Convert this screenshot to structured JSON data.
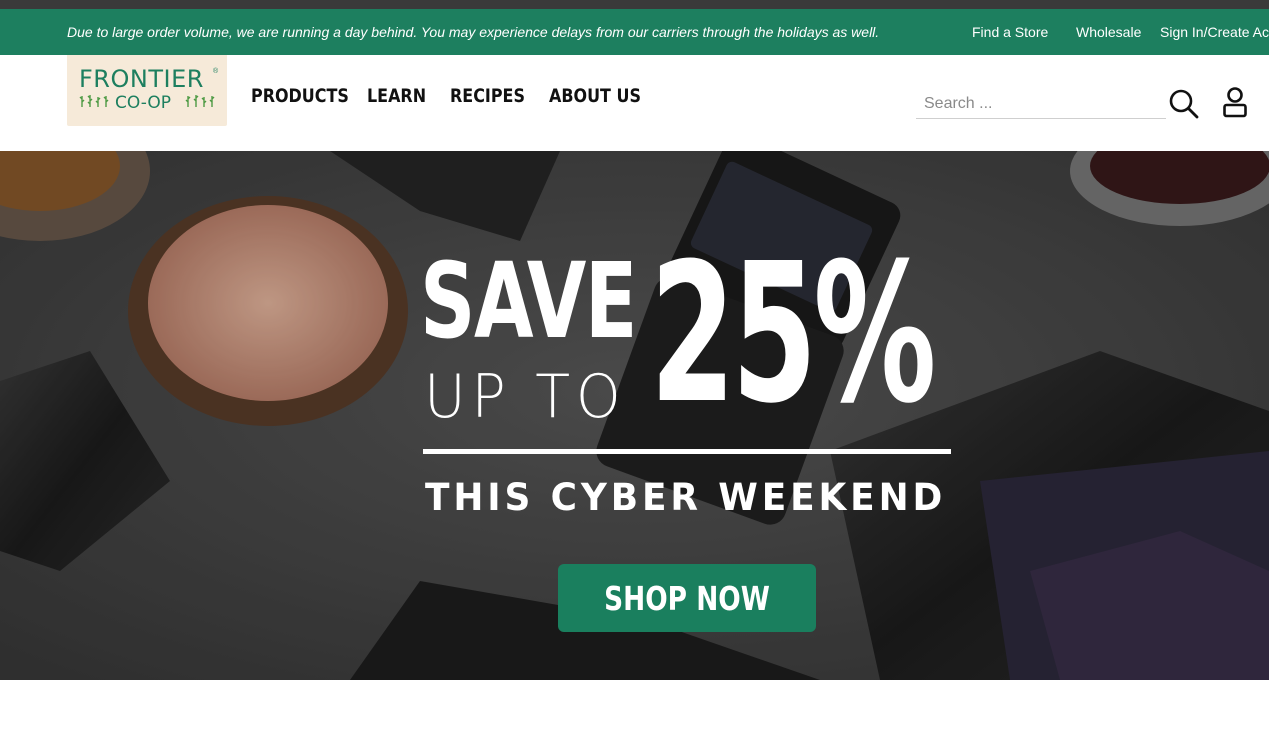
{
  "announcement": {
    "text": "Due to large order volume, we are running a day behind. You may experience delays from our carriers through the holidays as well."
  },
  "utility_nav": {
    "find_store": "Find a Store",
    "wholesale": "Wholesale",
    "sign_in": "Sign In/Create Ac"
  },
  "logo": {
    "line1": "FRONTIER",
    "line2": "CO-OP",
    "reg": "®"
  },
  "main_nav": {
    "items": [
      {
        "label": "PRODUCTS"
      },
      {
        "label": "LEARN"
      },
      {
        "label": "RECIPES"
      },
      {
        "label": "ABOUT US"
      }
    ]
  },
  "search": {
    "placeholder": "Search ...",
    "value": ""
  },
  "icons": {
    "search": "search-icon",
    "account": "user-icon"
  },
  "hero": {
    "save": "SAVE",
    "up_to": "UP TO",
    "percent": "25%",
    "subline": "THIS CYBER WEEKEND",
    "cta": "SHOP NOW"
  },
  "colors": {
    "brand_green": "#1d7f5f",
    "cta_green": "#1a7f5e",
    "logo_bg": "#f6ead9"
  }
}
